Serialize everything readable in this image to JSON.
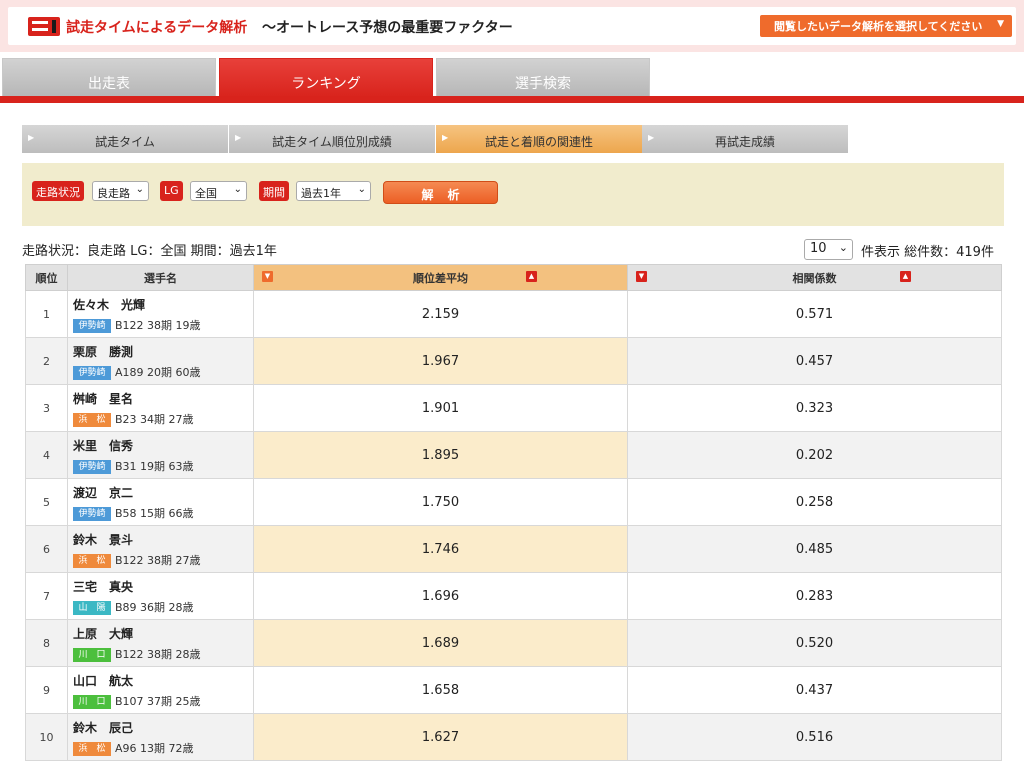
{
  "header": {
    "title_red": "試走タイムによるデータ解析",
    "title_black": "〜オートレース予想の最重要ファクター",
    "select_label": "閲覧したいデータ解析を選択してください",
    "select_caret": "▼"
  },
  "main_tabs": [
    "出走表",
    "ランキング",
    "選手検索"
  ],
  "sub_tabs": [
    "試走タイム",
    "試走タイム順位別成績",
    "試走と着順の関連性",
    "再試走成績"
  ],
  "filters": {
    "road_label": "走路状況",
    "road_value": "良走路",
    "lg_label": "LG",
    "lg_value": "全国",
    "period_label": "期間",
    "period_value": "過去1年",
    "analyze_button": "解析"
  },
  "summary": {
    "text": "走路状況：良走路 LG：全国 期間：過去1年",
    "page_size": "10",
    "count_text": "件表示 総件数：419件"
  },
  "table": {
    "headers": [
      "順位",
      "選手名",
      "順位差平均",
      "相関係数"
    ],
    "rows": [
      {
        "rank": "1",
        "name": "佐々木　光輝",
        "track": "伊勢崎",
        "info": "B122 38期 19歳",
        "avg": "2.159",
        "corr": "0.571"
      },
      {
        "rank": "2",
        "name": "栗原　勝測",
        "track": "伊勢崎",
        "info": "A189 20期 60歳",
        "avg": "1.967",
        "corr": "0.457"
      },
      {
        "rank": "3",
        "name": "桝崎　星名",
        "track": "浜　松",
        "info": "B23 34期 27歳",
        "avg": "1.901",
        "corr": "0.323"
      },
      {
        "rank": "4",
        "name": "米里　信秀",
        "track": "伊勢崎",
        "info": "B31 19期 63歳",
        "avg": "1.895",
        "corr": "0.202"
      },
      {
        "rank": "5",
        "name": "渡辺　京二",
        "track": "伊勢崎",
        "info": "B58 15期 66歳",
        "avg": "1.750",
        "corr": "0.258"
      },
      {
        "rank": "6",
        "name": "鈴木　景斗",
        "track": "浜　松",
        "info": "B122 38期 27歳",
        "avg": "1.746",
        "corr": "0.485"
      },
      {
        "rank": "7",
        "name": "三宅　真央",
        "track": "山　陽",
        "info": "B89 36期 28歳",
        "avg": "1.696",
        "corr": "0.283"
      },
      {
        "rank": "8",
        "name": "上原　大輝",
        "track": "川　口",
        "info": "B122 38期 28歳",
        "avg": "1.689",
        "corr": "0.520"
      },
      {
        "rank": "9",
        "name": "山口　航太",
        "track": "川　口",
        "info": "B107 37期 25歳",
        "avg": "1.658",
        "corr": "0.437"
      },
      {
        "rank": "10",
        "name": "鈴木　辰己",
        "track": "浜　松",
        "info": "A96 13期 72歳",
        "avg": "1.627",
        "corr": "0.516"
      }
    ]
  },
  "track_colors": {
    "伊勢崎": "#4d9ad8",
    "浜　松": "#ef8a3c",
    "山　陽": "#3bb8c4",
    "川　口": "#4cbf3d"
  },
  "icons": {
    "sort_desc": "▼",
    "sort_asc": "▲",
    "dropdown": "⌄"
  }
}
